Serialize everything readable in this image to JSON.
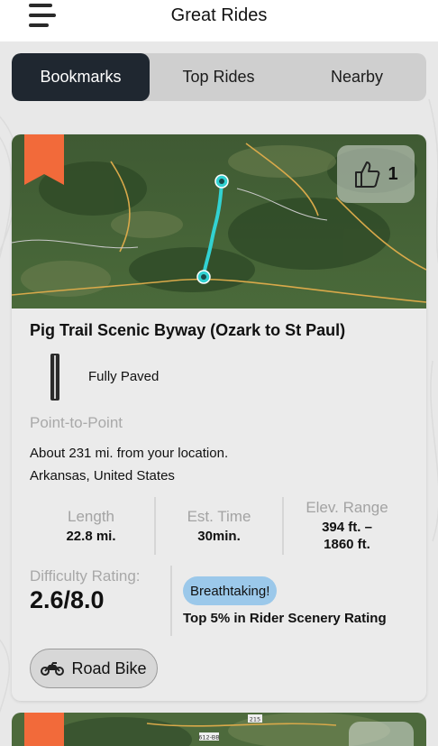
{
  "header": {
    "title": "Great Rides"
  },
  "tabs": [
    {
      "label": "Bookmarks",
      "active": true
    },
    {
      "label": "Top Rides",
      "active": false
    },
    {
      "label": "Nearby",
      "active": false
    }
  ],
  "ride": {
    "name": "Pig Trail Scenic Byway (Ozark to St Paul)",
    "likes": "1",
    "bookmarked": true,
    "surface": "Fully Paved",
    "route_type": "Point-to-Point",
    "distance": "About 231 mi. from your location.",
    "location": "Arkansas, United States",
    "stats": {
      "length_label": "Length",
      "length_value": "22.8 mi.",
      "time_label": "Est. Time",
      "time_value": "30min.",
      "elev_label": "Elev. Range",
      "elev_value_1": "394 ft. –",
      "elev_value_2": "1860 ft."
    },
    "difficulty_label": "Difficulty Rating:",
    "difficulty_value": "2.6/8.0",
    "scenery_badge": "Breathtaking!",
    "scenery_rank": "Top 5% in Rider Scenery Rating",
    "bike_type": "Road Bike"
  },
  "map_labels": {
    "road_a": "612-BB",
    "road_b": "215"
  },
  "colors": {
    "accent_dark": "#1f2730",
    "bookmark": "#f26a3a",
    "route": "#32d2d2",
    "badge": "#9bc8ea"
  },
  "icons": {
    "menu": "hamburger-icon",
    "bookmark": "bookmark-flag-icon",
    "like": "thumbs-up-icon",
    "bike": "motorcycle-icon"
  }
}
